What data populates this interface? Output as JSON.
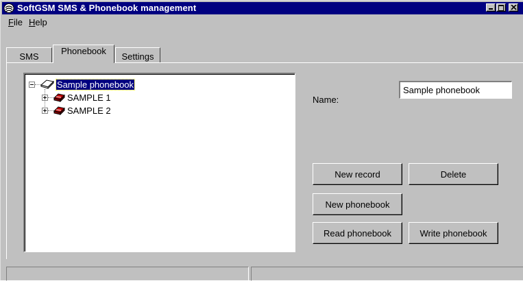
{
  "window": {
    "title": "SoftGSM SMS & Phonebook management",
    "icon": "phone-icon",
    "controls": [
      "minimize-icon",
      "maximize-icon",
      "close-icon"
    ]
  },
  "menu": {
    "items": [
      {
        "label": "File"
      },
      {
        "label": "Help"
      }
    ]
  },
  "tabs": [
    {
      "label": "SMS",
      "selected": false
    },
    {
      "label": "Phonebook",
      "selected": true
    },
    {
      "label": "Settings",
      "selected": false
    }
  ],
  "tree": {
    "root": {
      "label": "Sample phonebook",
      "icon": "book-icon",
      "selected": true,
      "expanded": true
    },
    "children": [
      {
        "label": "SAMPLE 1",
        "icon": "phone-icon",
        "expanded": false
      },
      {
        "label": "SAMPLE 2",
        "icon": "phone-icon",
        "expanded": false
      }
    ]
  },
  "form": {
    "name_label": "Name:",
    "name_value": "Sample phonebook"
  },
  "buttons": {
    "new_record": "New record",
    "delete": "Delete",
    "new_phonebook": "New phonebook",
    "read_phonebook": "Read phonebook",
    "write_phonebook": "Write phonebook"
  },
  "statusbar": {
    "panes": [
      "",
      ""
    ]
  },
  "colors": {
    "titlebar": "#000080",
    "face": "#c0c0c0",
    "selection": "#000080"
  }
}
